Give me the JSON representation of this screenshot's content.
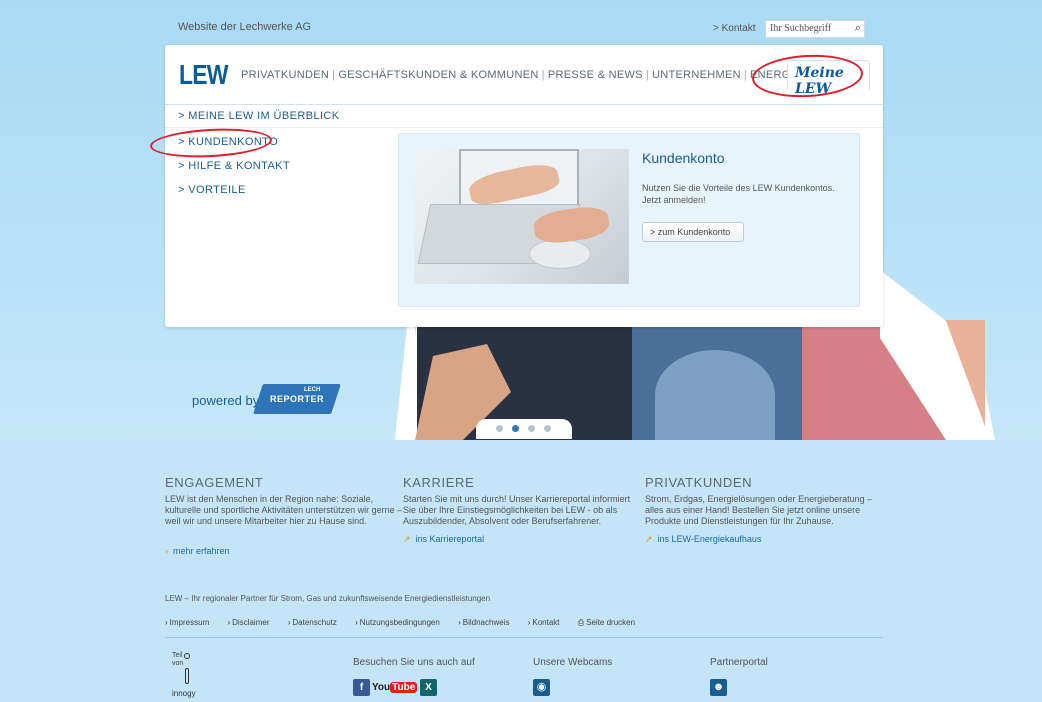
{
  "topbar": {
    "site_title": "Website der Lechwerke AG",
    "contact_link": "> Kontakt",
    "search_placeholder": "Ihr Suchbegriff",
    "search_icon": "⌕"
  },
  "header": {
    "logo": "LEW",
    "nav": [
      "PRIVATKUNDEN",
      "GESCHÄFTSKUNDEN & KOMMUNEN",
      "PRESSE & NEWS",
      "UNTERNEHMEN",
      "ENERGIEZUKUNFT"
    ],
    "meine_tab": "Meine LEW"
  },
  "submenu": {
    "items": [
      ">  MEINE LEW IM ÜBERBLICK",
      ">  KUNDENKONTO",
      ">  HILFE & KONTAKT",
      ">  VORTEILE"
    ]
  },
  "teaser": {
    "title": "Kundenkonto",
    "text": "Nutzen Sie die Vorteile des LEW Kundenkontos. Jetzt anmelden!",
    "button": "> zum Kundenkonto"
  },
  "hero": {
    "powered_by": "powered by",
    "reporter_top": "LECH",
    "reporter_main": "REPORTER",
    "slides": 4,
    "active_slide": 2
  },
  "footer": {
    "columns": [
      {
        "title": "ENGAGEMENT",
        "text": "LEW ist den Menschen in der Region nahe: Soziale, kulturelle und sportliche Aktivitäten unterstützen wir gerne – weil wir und unsere Mitarbeiter hier zu Hause sind.",
        "link": "mehr erfahren"
      },
      {
        "title": "KARRIERE",
        "text": "Starten Sie mit uns durch! Unser Karriereportal informiert Sie über Ihre Einstiegsmöglichkeiten bei LEW - ob als Auszubildender, Absolvent oder Berufserfahrener.",
        "link": "ins Karriereportal"
      },
      {
        "title": "PRIVATKUNDEN",
        "text": "Strom, Erdgas, Energielösungen oder Energieberatung – alles aus einer Hand! Bestellen Sie jetzt online unsere Produkte und Dienstleistungen für Ihr Zuhause.",
        "link": "ins LEW-Energiekaufhaus"
      }
    ],
    "tagline": "LEW – Ihr regionaler Partner für Strom, Gas und zukunftsweisende Energiedienstleistungen",
    "legal": [
      "Impressum",
      "Disclaimer",
      "Datenschutz",
      "Nutzungsbedingungen",
      "Bildnachweis",
      "Kontakt",
      "Seite drucken"
    ],
    "innogy_teil": "Teil",
    "innogy_von": "von",
    "innogy_name": "innogy",
    "visit_label": "Besuchen Sie uns auch auf",
    "webcams_label": "Unsere Webcams",
    "partner_label": "Partnerportal",
    "social": {
      "facebook": "f",
      "youtube_you": "You",
      "youtube_tube": "Tube",
      "xing": "X"
    },
    "colors": {
      "brand": "#0a5b9f",
      "annotation": "#e11d2a",
      "link_arrow": "#e09a00"
    }
  }
}
